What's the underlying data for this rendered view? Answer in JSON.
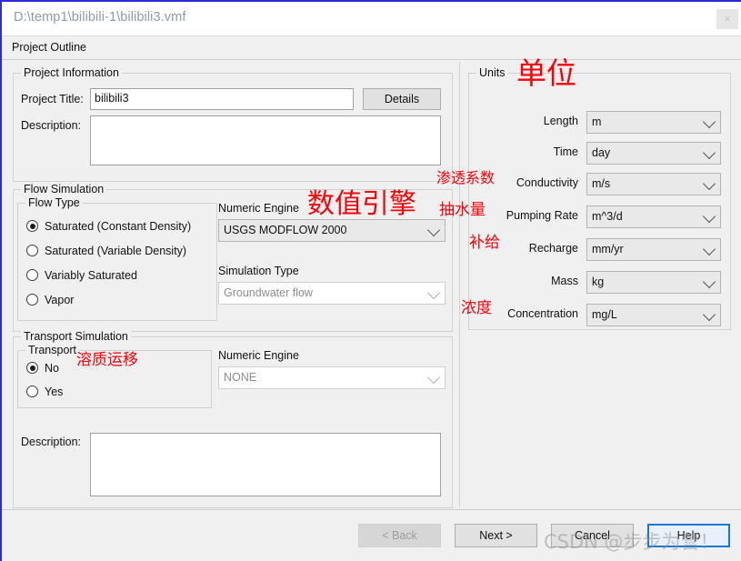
{
  "window": {
    "title": "D:\\temp1\\bilibili-1\\bilibili3.vmf",
    "close_glyph": "×"
  },
  "page_header": {
    "text": "Project Outline"
  },
  "project_information": {
    "group_title": "Project Information",
    "title_label": "Project Title:",
    "title_value": "bilibili3",
    "details_button": "Details",
    "description_label": "Description:",
    "description_value": ""
  },
  "flow_simulation": {
    "group_title": "Flow Simulation",
    "flow_type": {
      "group_title": "Flow Type",
      "options": [
        {
          "label": "Saturated (Constant Density)",
          "selected": true
        },
        {
          "label": "Saturated (Variable Density)",
          "selected": false
        },
        {
          "label": "Variably Saturated",
          "selected": false
        },
        {
          "label": "Vapor",
          "selected": false
        }
      ]
    },
    "numeric_engine_label": "Numeric Engine",
    "numeric_engine_value": "USGS MODFLOW 2000",
    "simulation_type_label": "Simulation Type",
    "simulation_type_value": "Groundwater flow"
  },
  "transport_simulation": {
    "group_title": "Transport Simulation",
    "transport": {
      "group_title": "Transport",
      "options": [
        {
          "label": "No",
          "selected": true
        },
        {
          "label": "Yes",
          "selected": false
        }
      ]
    },
    "numeric_engine_label": "Numeric Engine",
    "numeric_engine_value": "NONE",
    "description_label": "Description:",
    "description_value": ""
  },
  "units": {
    "group_title": "Units",
    "rows": [
      {
        "label": "Length",
        "value": "m"
      },
      {
        "label": "Time",
        "value": "day"
      },
      {
        "label": "Conductivity",
        "value": "m/s"
      },
      {
        "label": "Pumping Rate",
        "value": "m^3/d"
      },
      {
        "label": "Recharge",
        "value": "mm/yr"
      },
      {
        "label": "Mass",
        "value": "kg"
      },
      {
        "label": "Concentration",
        "value": "mg/L"
      }
    ]
  },
  "footer": {
    "back_button": "< Back",
    "next_button": "Next >",
    "cancel_button": "Cancel",
    "help_button": "Help"
  },
  "annotations": {
    "units": "单位",
    "conductivity": "渗透系数",
    "numeric_engine": "数值引擎",
    "pumping_rate": "抽水量",
    "recharge": "补给",
    "concentration": "浓度",
    "transport": "溶质运移"
  },
  "watermark": {
    "text": "CSDN @步步为营！"
  },
  "colors": {
    "accent": "#1678d2",
    "annotation_red": "#fb0007",
    "window_bg": "#f0f0f0",
    "title_text": "#8f9aa6"
  }
}
